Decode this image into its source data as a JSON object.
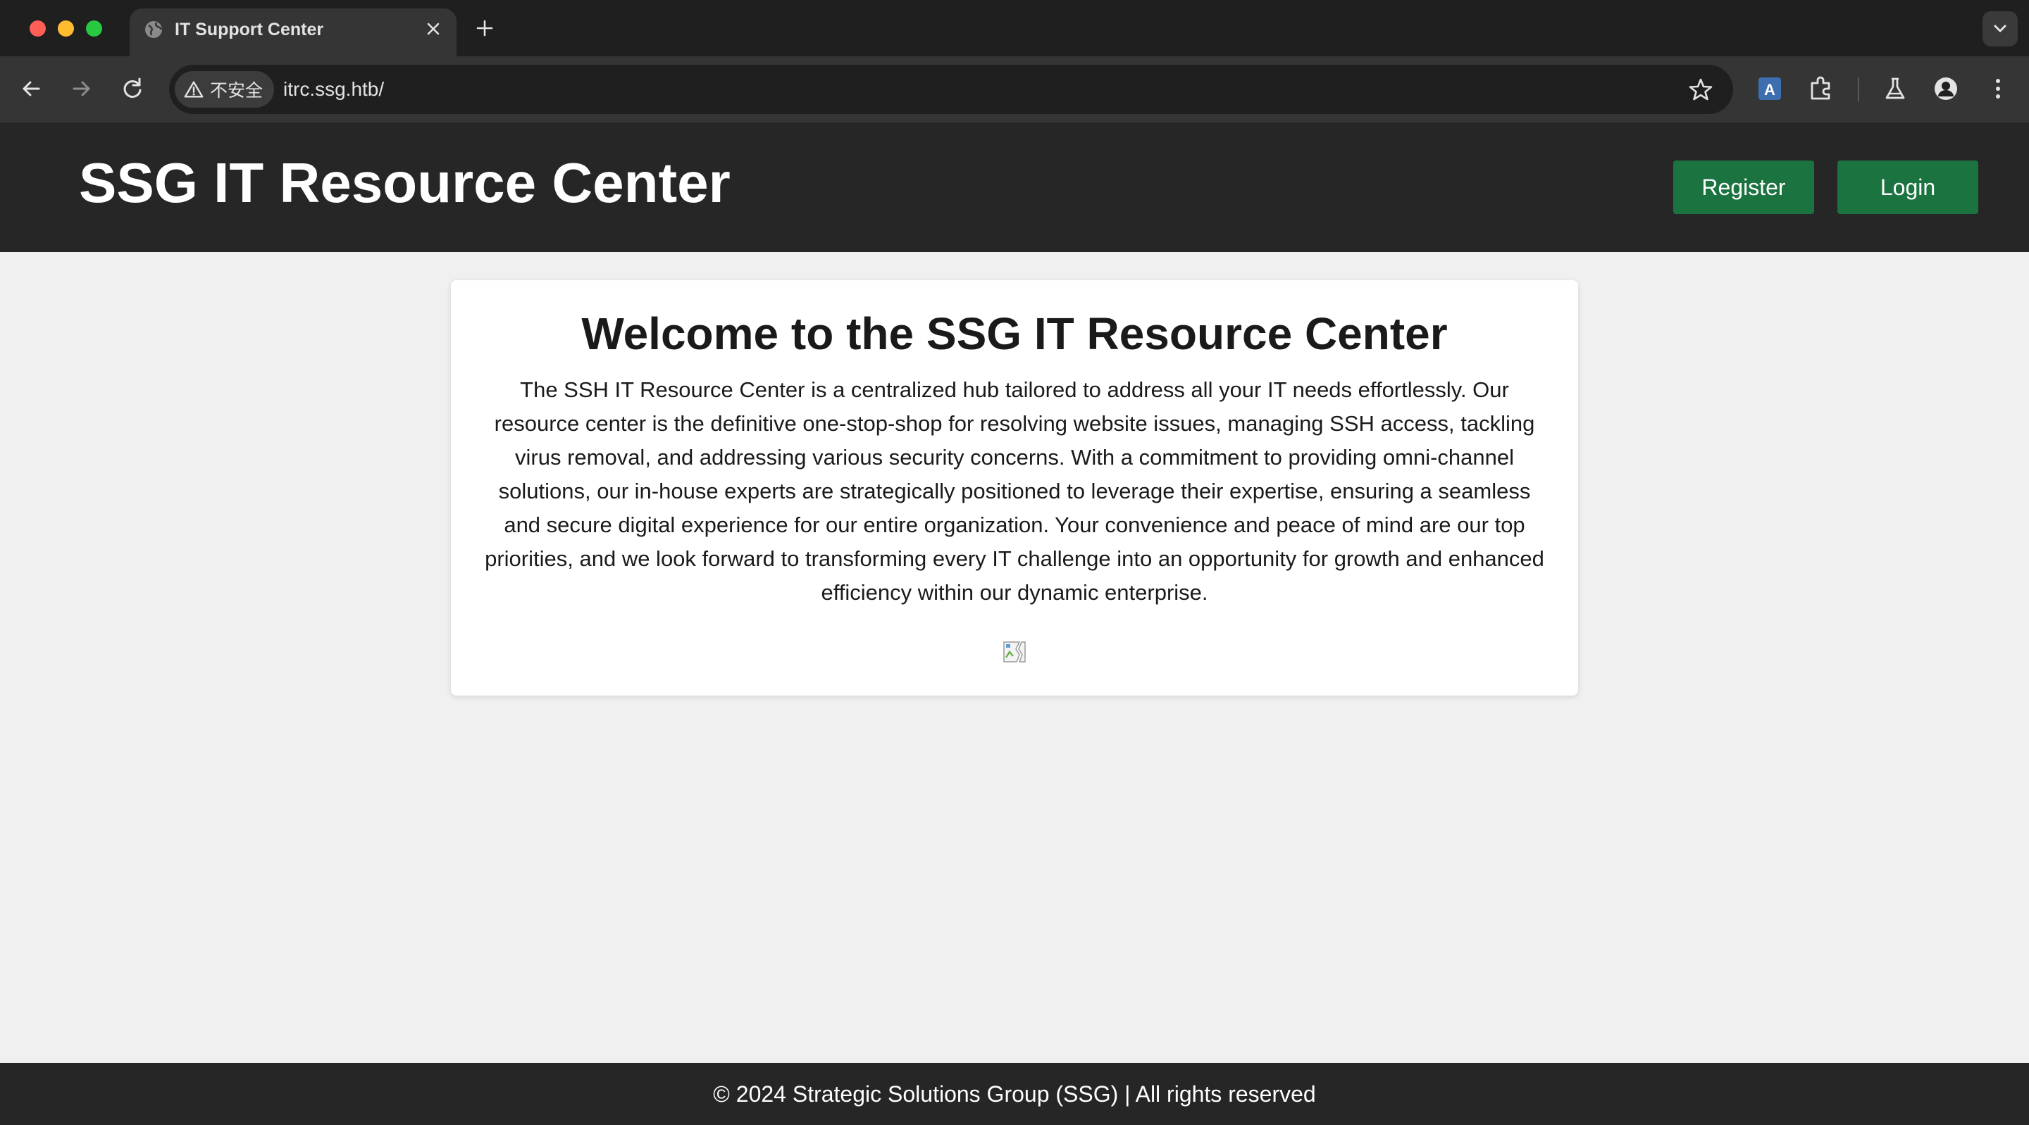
{
  "browser": {
    "tab": {
      "title": "IT Support Center"
    },
    "address_bar": {
      "security_label": "不安全",
      "url": "itrc.ssg.htb/"
    },
    "icons": [
      "back-arrow-icon",
      "forward-arrow-icon",
      "reload-icon",
      "warning-icon",
      "star-icon",
      "translate-icon",
      "extensions-icon",
      "labs-flask-icon",
      "profile-icon",
      "menu-icon"
    ]
  },
  "header": {
    "site_title": "SSG IT Resource Center",
    "register_label": "Register",
    "login_label": "Login",
    "button_color": "#1b7340"
  },
  "main": {
    "heading": "Welcome to the SSG IT Resource Center",
    "description": "The SSH IT Resource Center is a centralized hub tailored to address all your IT needs effortlessly. Our resource center is the definitive one-stop-shop for resolving website issues, managing SSH access, tackling virus removal, and addressing various security concerns. With a commitment to providing omni-channel solutions, our in-house experts are strategically positioned to leverage their expertise, ensuring a seamless and secure digital experience for our entire organization. Your convenience and peace of mind are our top priorities, and we look forward to transforming every IT challenge into an opportunity for growth and enhanced efficiency within our dynamic enterprise.",
    "image": "broken-image-icon"
  },
  "footer": {
    "text": "© 2024 Strategic Solutions Group (SSG) | All rights reserved"
  }
}
